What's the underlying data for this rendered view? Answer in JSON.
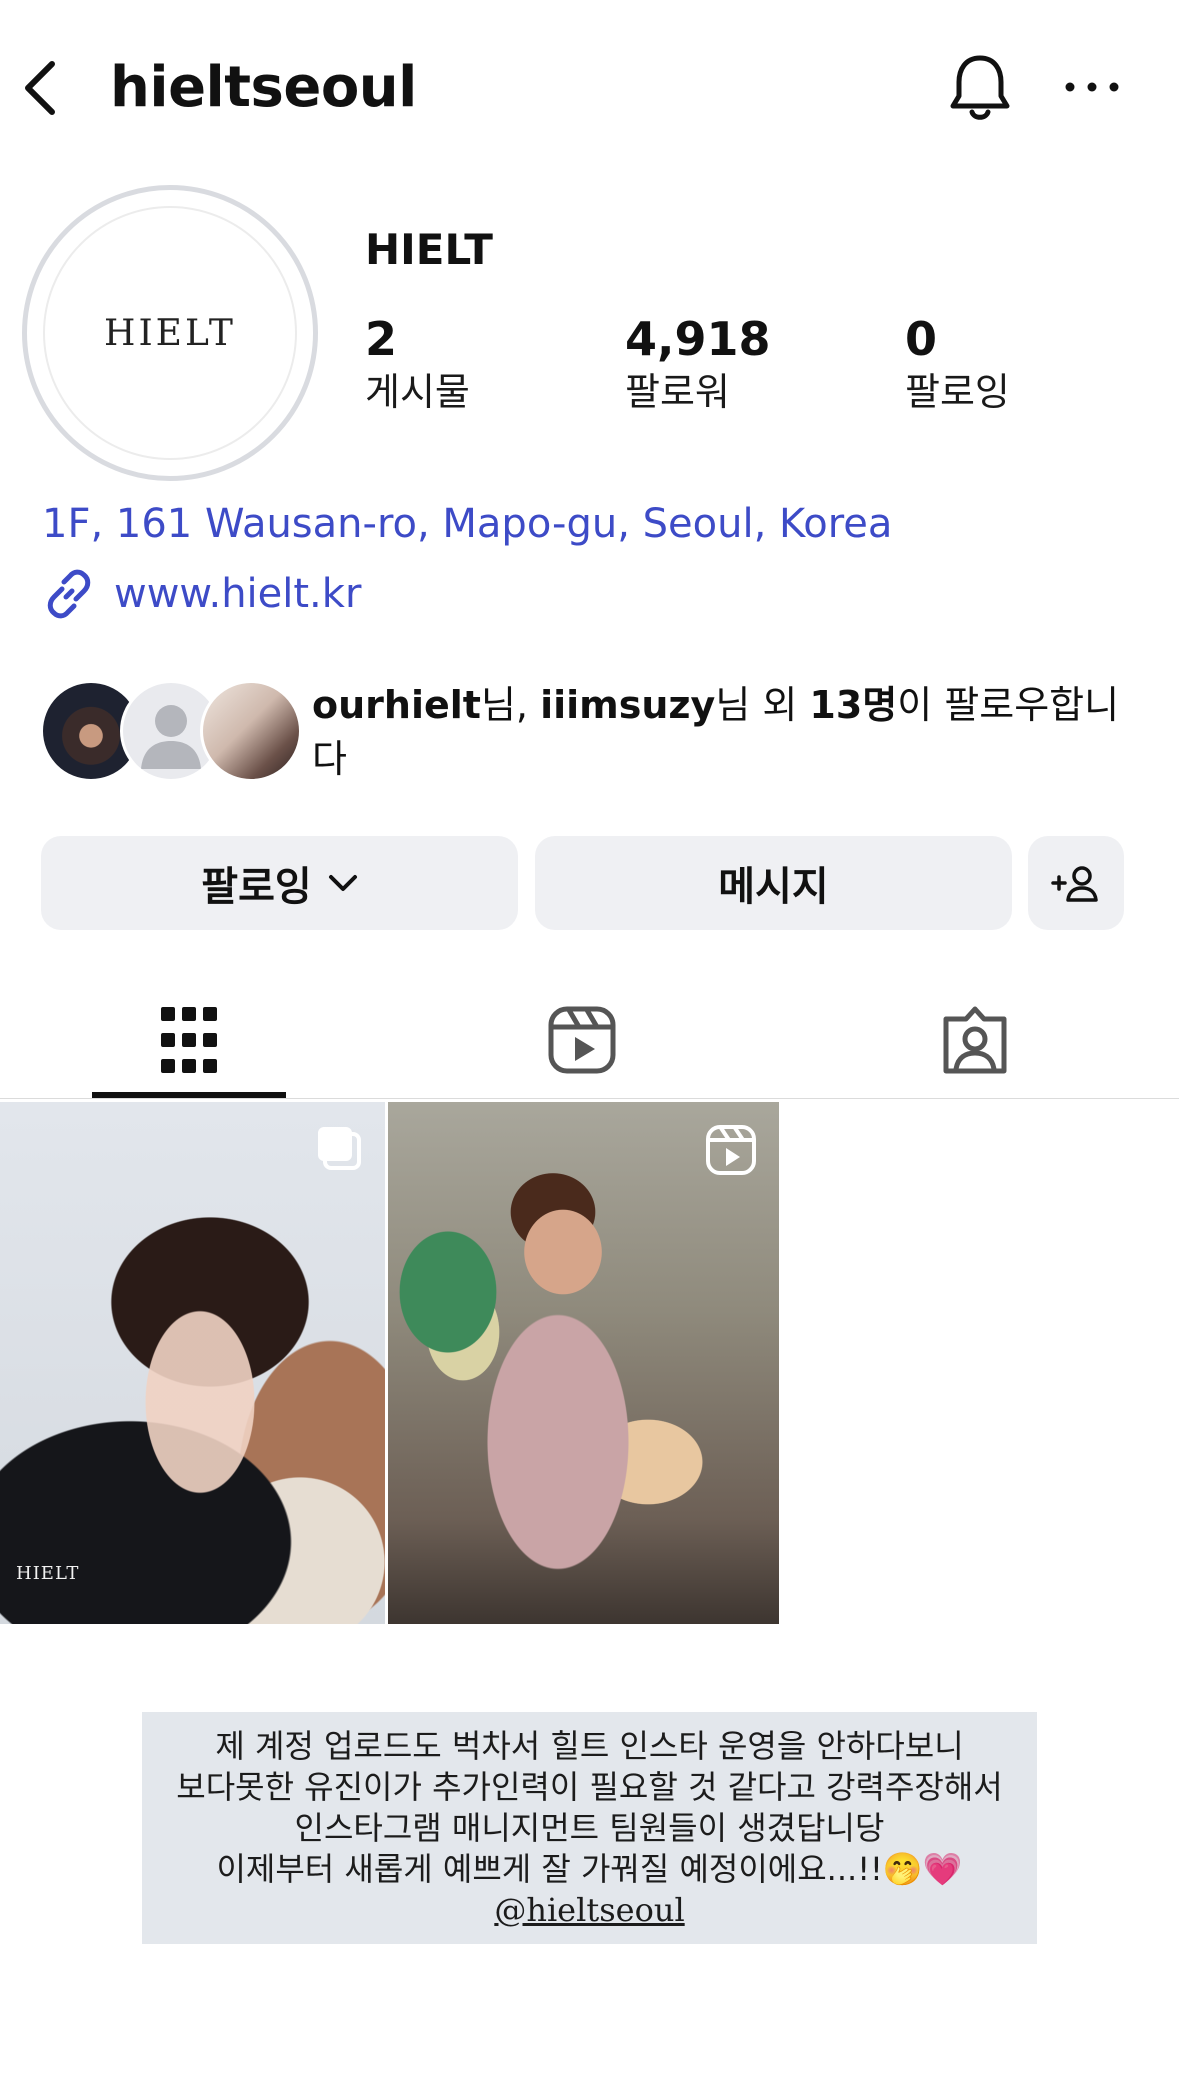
{
  "header": {
    "username": "hieltseoul"
  },
  "profile": {
    "avatar_text": "HIELT",
    "display_name": "HIELT",
    "stats": [
      {
        "value": "2",
        "label": "게시물"
      },
      {
        "value": "4,918",
        "label": "팔로워"
      },
      {
        "value": "0",
        "label": "팔로잉"
      }
    ],
    "address": "1F, 161 Wausan-ro, Mapo-gu, Seoul, Korea",
    "website": "www.hielt.kr"
  },
  "followed_by": {
    "user1": "ourhielt",
    "sep1": "님, ",
    "user2": "iiimsuzy",
    "sep2": "님 외 ",
    "count": "13명",
    "suffix": "이 팔로우합니다"
  },
  "buttons": {
    "following": "팔로잉",
    "message": "메시지"
  },
  "tabs": [
    "posts",
    "reels",
    "tagged"
  ],
  "posts": [
    {
      "brand": "HIELT",
      "type": "carousel"
    },
    {
      "type": "reel"
    }
  ],
  "caption": {
    "lines": [
      "제 계정 업로드도 벅차서 힐트 인스타 운영을 안하다보니",
      "보다못한 유진이가 추가인력이 필요할 것 같다고 강력주장해서",
      "인스타그램 매니지먼트 팀원들이 생겼답니당",
      "이제부터 새롭게 예쁘게 잘 가꿔질 예정이에요...!!🤭💗"
    ],
    "handle": "@hieltseoul"
  },
  "colors": {
    "link": "#3d4bc7",
    "button_bg": "#eff0f3",
    "caption_bg": "#e3e7ec"
  }
}
